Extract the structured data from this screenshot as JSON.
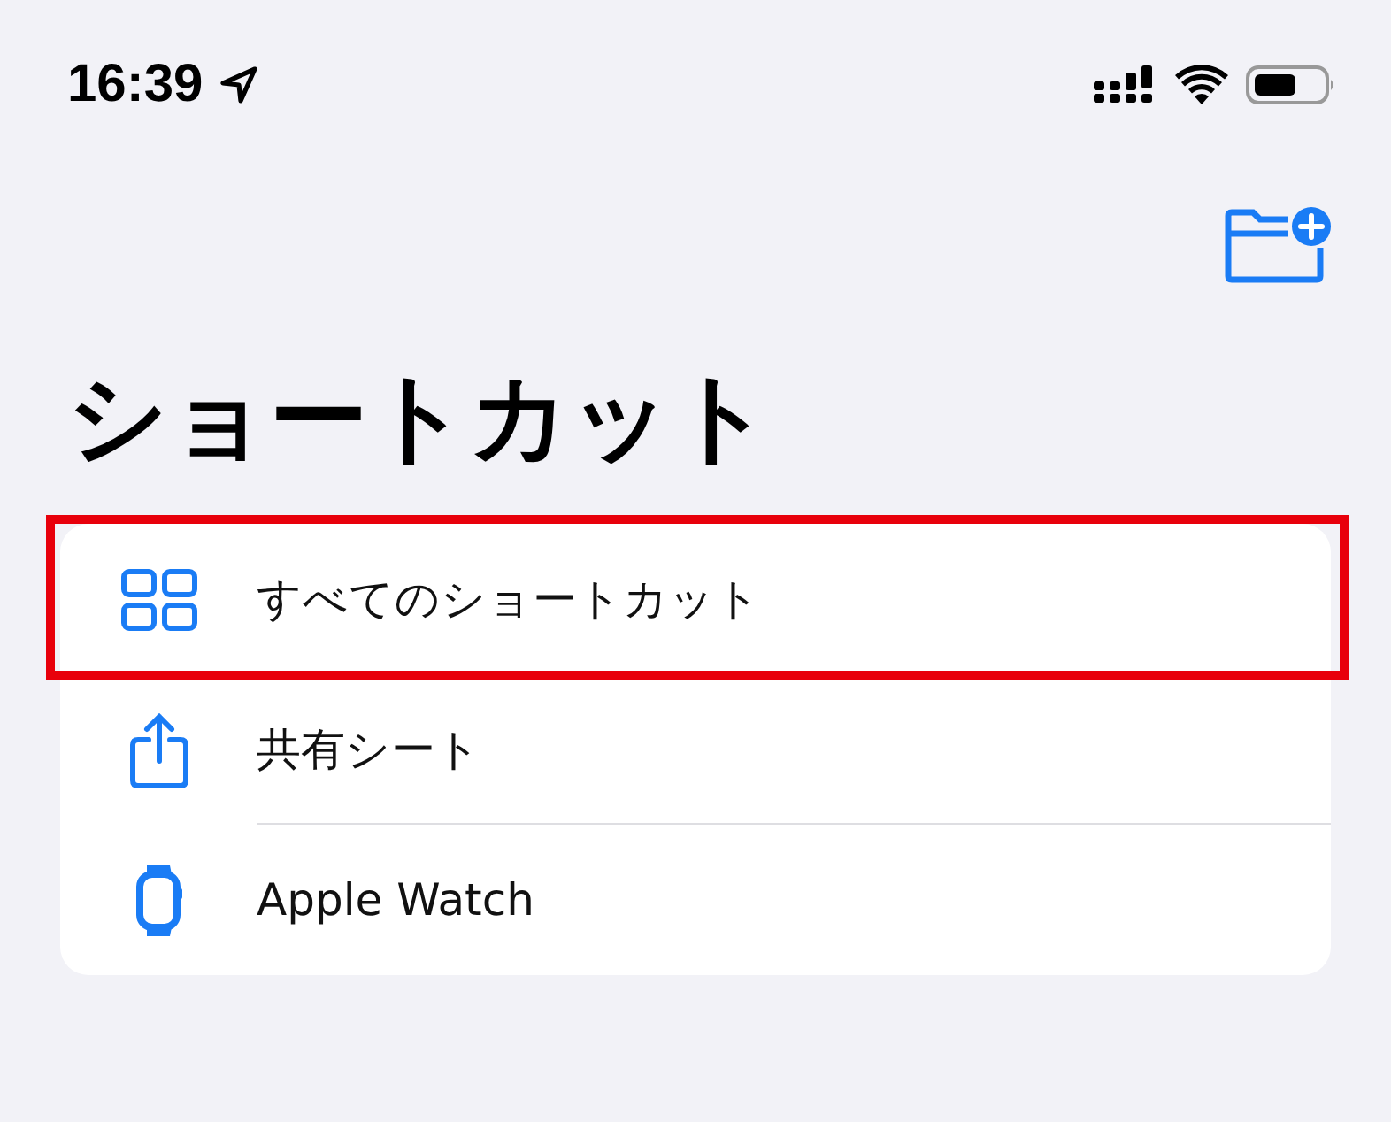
{
  "status_bar": {
    "time": "16:39"
  },
  "title": "ショートカット",
  "items": [
    {
      "kind": "grid",
      "label": "すべてのショートカット",
      "highlighted": true
    },
    {
      "kind": "share",
      "label": "共有シート",
      "highlighted": false
    },
    {
      "kind": "watch",
      "label": "Apple Watch",
      "highlighted": false
    }
  ]
}
